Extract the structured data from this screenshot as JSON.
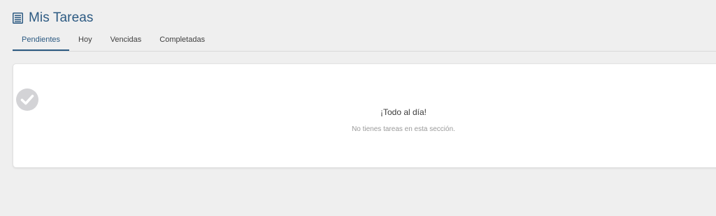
{
  "header": {
    "icon": "task-list-icon",
    "title": "Mis Tareas"
  },
  "tabs": [
    {
      "label": "Pendientes",
      "active": true
    },
    {
      "label": "Hoy",
      "active": false
    },
    {
      "label": "Vencidas",
      "active": false
    },
    {
      "label": "Completadas",
      "active": false
    }
  ],
  "empty_state": {
    "icon": "check-circle-icon",
    "title": "¡Todo al día!",
    "message": "No tienes tareas en esta sección."
  },
  "colors": {
    "accent": "#2c5a82",
    "background": "#efefef",
    "card": "#ffffff",
    "icon_muted": "#d3d3d6"
  }
}
